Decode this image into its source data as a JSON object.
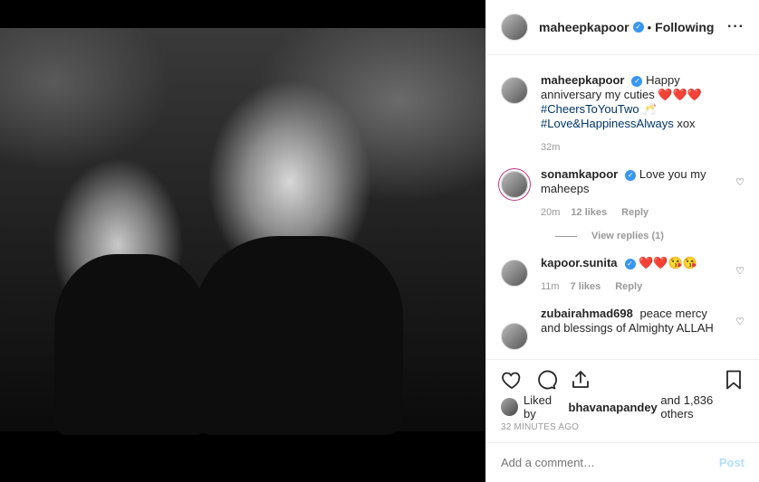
{
  "post": {
    "author": "maheepkapoor",
    "follow_status": "Following",
    "dot": "•",
    "more": "···"
  },
  "caption": {
    "user": "maheepkapoor",
    "line1": "Happy anniversary my cuties ❤️❤️❤️",
    "tag1": "#CheersToYouTwo",
    "emoji": "🥂",
    "tag2": "#Love&HappinessAlways",
    "tail": "xox",
    "time": "32m"
  },
  "comments": [
    {
      "user": "sonamkapoor",
      "text": "Love you my maheeps",
      "time": "20m",
      "likes": "12 likes",
      "reply": "Reply",
      "view_replies": "View replies (1)"
    },
    {
      "user": "kapoor.sunita",
      "text": "❤️❤️😘😘",
      "time": "11m",
      "likes": "7 likes",
      "reply": "Reply"
    },
    {
      "user": "zubairahmad698",
      "text": "peace mercy and blessings of Almighty ALLAH"
    }
  ],
  "likes": {
    "prefix": "Liked by",
    "user": "bhavanapandey",
    "suffix": "and 1,836 others"
  },
  "timestamp": "32 MINUTES AGO",
  "add_comment": {
    "placeholder": "Add a comment…",
    "post_label": "Post"
  },
  "icons": [
    "heart-icon",
    "comment-icon",
    "share-icon",
    "bookmark-icon",
    "verified-icon",
    "more-icon"
  ],
  "colors": {
    "verified": "#3897f0",
    "hashtag": "#003569",
    "meta": "#999999",
    "post_disabled": "#b2dffc"
  }
}
